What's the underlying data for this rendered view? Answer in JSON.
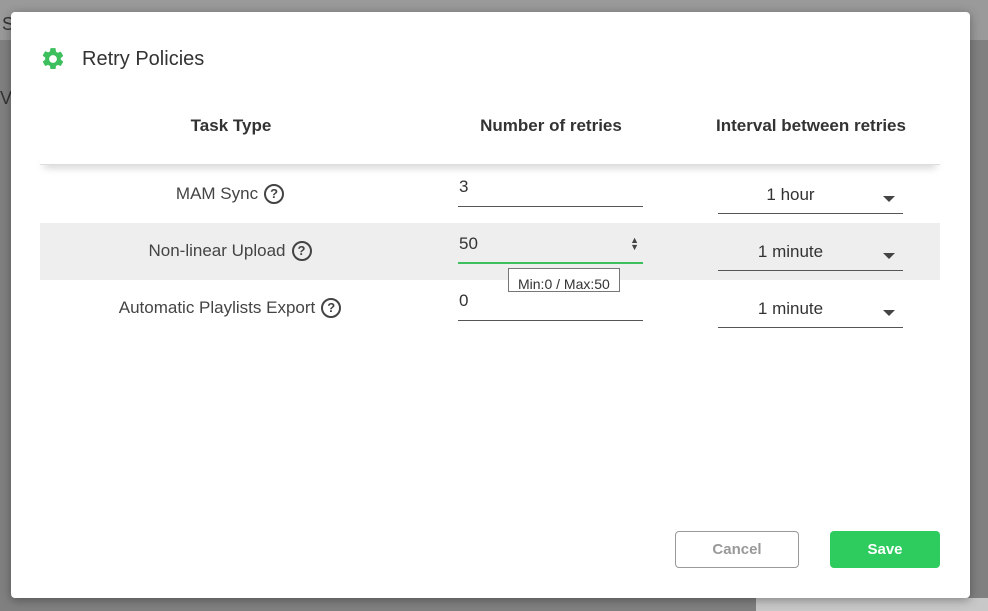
{
  "dialog": {
    "title": "Retry Policies",
    "accent_color": "#3cbf5c",
    "icon": "gear-icon"
  },
  "table": {
    "headers": [
      "Task Type",
      "Number of retries",
      "Interval between retries"
    ],
    "rows": [
      {
        "task": "MAM Sync",
        "retries": "3",
        "interval": "1 hour"
      },
      {
        "task": "Non-linear Upload",
        "retries": "50",
        "interval": "1 minute"
      },
      {
        "task": "Automatic Playlists Export",
        "retries": "0",
        "interval": "1 minute"
      }
    ]
  },
  "tooltip": "Min:0 / Max:50",
  "buttons": {
    "cancel": "Cancel",
    "save": "Save"
  },
  "background": {
    "chars": [
      "S",
      "Vi"
    ]
  }
}
